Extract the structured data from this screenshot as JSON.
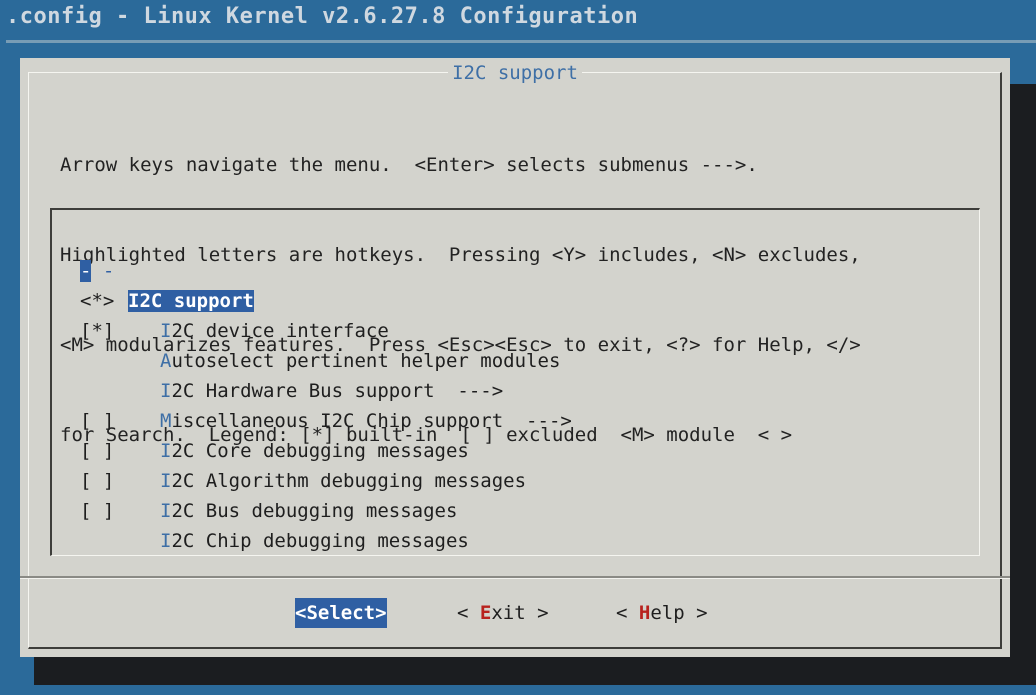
{
  "backtitle": ".config - Linux Kernel v2.6.27.8 Configuration",
  "dialog": {
    "title": "I2C support",
    "help_lines": [
      "Arrow keys navigate the menu.  <Enter> selects submenus --->.",
      "Highlighted letters are hotkeys.  Pressing <Y> includes, <N> excludes,",
      "<M> modularizes features.  Press <Esc><Esc> to exit, <?> for Help, </>",
      "for Search.  Legend: [*] built-in  [ ] excluded  <M> module  < >"
    ]
  },
  "menu": {
    "selected": {
      "mark_first": "-",
      "mark_second": "-",
      "label": "I2C support"
    },
    "items": [
      {
        "mark": "<*>",
        "hotkey": "I",
        "rest": "2C device interface"
      },
      {
        "mark": "[*]",
        "hotkey": "A",
        "rest": "utoselect pertinent helper modules"
      },
      {
        "mark": "",
        "hotkey": "I",
        "rest": "2C Hardware Bus support  --->"
      },
      {
        "mark": "",
        "hotkey": "M",
        "rest": "iscellaneous I2C Chip support  --->"
      },
      {
        "mark": "[ ]",
        "hotkey": "I",
        "rest": "2C Core debugging messages"
      },
      {
        "mark": "[ ]",
        "hotkey": "I",
        "rest": "2C Algorithm debugging messages"
      },
      {
        "mark": "[ ]",
        "hotkey": "I",
        "rest": "2C Bus debugging messages"
      },
      {
        "mark": "[ ]",
        "hotkey": "I",
        "rest": "2C Chip debugging messages"
      }
    ]
  },
  "buttons": {
    "select": {
      "pre": "<",
      "hot": "S",
      "post": "elect>"
    },
    "exit": {
      "pre": "< ",
      "hot": "E",
      "post": "xit >"
    },
    "help": {
      "pre": "< ",
      "hot": "H",
      "post": "elp >"
    }
  },
  "colors": {
    "background": "#2b6a9a",
    "dialog": "#d3d3cd",
    "highlight": "#2f5fa3",
    "hotkey": "#3e6fa6",
    "button_hotkey": "#b8221e"
  }
}
